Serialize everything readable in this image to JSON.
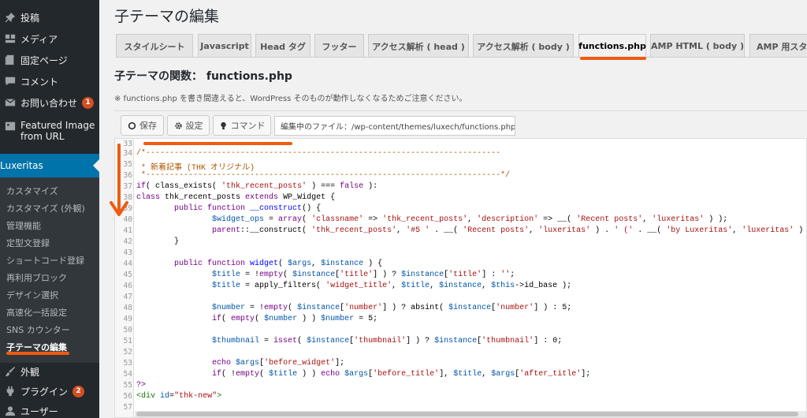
{
  "sidebar": {
    "items": [
      {
        "label": "投稿",
        "icon": "pin-icon"
      },
      {
        "label": "メディア",
        "icon": "media-icon"
      },
      {
        "label": "固定ページ",
        "icon": "page-icon"
      },
      {
        "label": "コメント",
        "icon": "comment-icon"
      },
      {
        "label": "お問い合わせ",
        "icon": "mail-icon",
        "badge": "1"
      },
      {
        "label": "Featured Image",
        "label2": "from URL",
        "icon": "image-icon"
      }
    ],
    "active": {
      "label": "Luxeritas",
      "icon": "grid-icon"
    },
    "submenu": [
      "カスタマイズ",
      "カスタマイズ (外観)",
      "管理機能",
      "定型文登録",
      "ショートコード登録",
      "再利用ブロック",
      "デザイン選択",
      "高速化一括設定",
      "SNS カウンター",
      "子テーマの編集"
    ],
    "bottom_items": [
      {
        "label": "外観",
        "icon": "brush-icon"
      },
      {
        "label": "プラグイン",
        "icon": "plugin-icon",
        "badge": "2"
      },
      {
        "label": "ユーザー",
        "icon": "user-icon"
      }
    ]
  },
  "page_title": "子テーマの編集",
  "tabs": [
    "スタイルシート",
    "Javascript",
    "Head タグ",
    "フッター",
    "アクセス解析 ( head )",
    "アクセス解析 ( body )",
    "functions.php",
    "AMP HTML ( body )",
    "AMP 用スタ"
  ],
  "section_title": "子テーマの関数： functions.php",
  "notice": "※ functions.php を書き間違えると、WordPress そのものが動作しなくなるためご注意ください。",
  "toolbar": {
    "save_label": "保存",
    "settings_label": "設定",
    "command_label": "コマンド",
    "file_path": "編集中のファイル：/wp-content/themes/luxech/functions.php"
  },
  "editor": {
    "line_numbers": [
      "33",
      "34",
      "35",
      "36",
      "37",
      "38",
      "39",
      "40",
      "41",
      "42",
      "43",
      "44",
      "45",
      "46",
      "47",
      "48",
      "49",
      "50",
      "51",
      "52",
      "53",
      "54",
      "55",
      "56",
      "57"
    ]
  },
  "colors": {
    "sidebar_bg": "#23282d",
    "active_blue": "#0073aa",
    "annotation_orange": "#f05a13",
    "badge_red": "#d54e21"
  }
}
